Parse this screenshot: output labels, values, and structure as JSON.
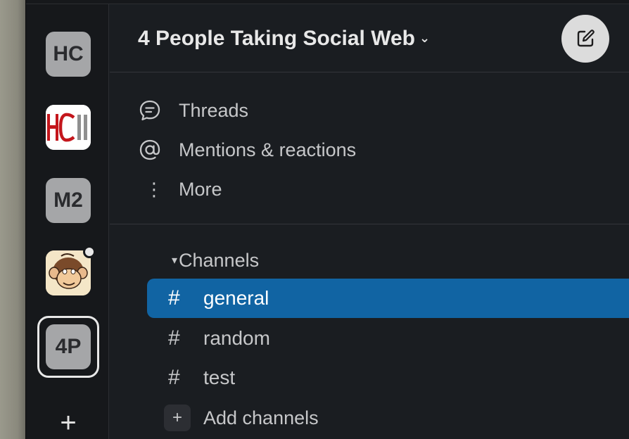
{
  "rail": {
    "workspaces": [
      {
        "label": "HC"
      },
      {
        "label": "HCII"
      },
      {
        "label": "M2"
      },
      {
        "label": "4P"
      }
    ],
    "add_symbol": "+"
  },
  "header": {
    "title": "4 People Taking Social Web",
    "chevron": "⌄"
  },
  "nav": {
    "threads": "Threads",
    "mentions": "Mentions & reactions",
    "more": "More",
    "more_symbol": "⋮"
  },
  "channels": {
    "heading": "Channels",
    "caret": "▾",
    "hash": "#",
    "items": [
      {
        "name": "general"
      },
      {
        "name": "random"
      },
      {
        "name": "test"
      }
    ],
    "add_label": "Add channels",
    "add_symbol": "+"
  },
  "colors": {
    "background": "#1a1d21",
    "rail": "#16181b",
    "active_channel": "#1164a3",
    "hcii_red": "#c4161c"
  }
}
